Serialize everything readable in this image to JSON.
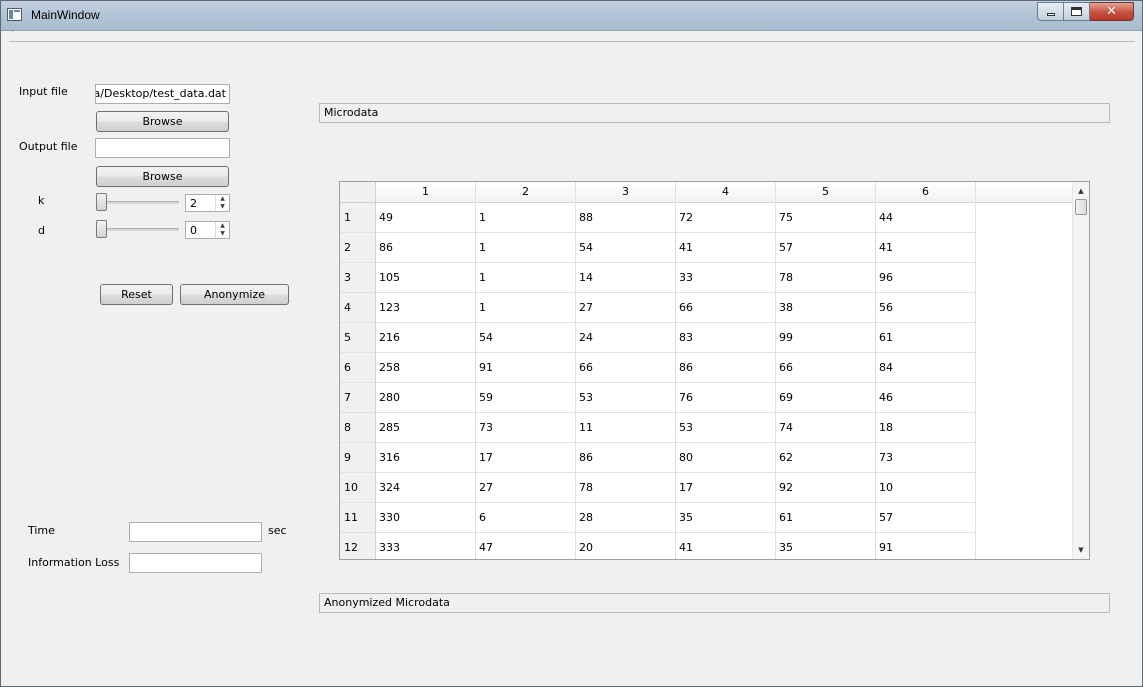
{
  "window": {
    "title": "MainWindow"
  },
  "menubar": {
    "marker": "·"
  },
  "form": {
    "input_label": "Input file",
    "input_value": "rina/Desktop/test_data.dat",
    "browse1_label": "Browse",
    "output_label": "Output file",
    "output_value": "",
    "browse2_label": "Browse",
    "k_label": "k",
    "k_value": "2",
    "d_label": "d",
    "d_value": "0",
    "reset_label": "Reset",
    "anonymize_label": "Anonymize",
    "time_label": "Time",
    "time_value": "",
    "time_unit": "sec",
    "info_loss_label": "Information Loss",
    "info_loss_value": ""
  },
  "microdata": {
    "title": "Microdata",
    "columns": [
      "1",
      "2",
      "3",
      "4",
      "5",
      "6"
    ],
    "row_headers": [
      "1",
      "2",
      "3",
      "4",
      "5",
      "6",
      "7",
      "8",
      "9",
      "10",
      "11",
      "12"
    ],
    "rows": [
      [
        "49",
        "1",
        "88",
        "72",
        "75",
        "44"
      ],
      [
        "86",
        "1",
        "54",
        "41",
        "57",
        "41"
      ],
      [
        "105",
        "1",
        "14",
        "33",
        "78",
        "96"
      ],
      [
        "123",
        "1",
        "27",
        "66",
        "38",
        "56"
      ],
      [
        "216",
        "54",
        "24",
        "83",
        "99",
        "61"
      ],
      [
        "258",
        "91",
        "66",
        "86",
        "66",
        "84"
      ],
      [
        "280",
        "59",
        "53",
        "76",
        "69",
        "46"
      ],
      [
        "285",
        "73",
        "11",
        "53",
        "74",
        "18"
      ],
      [
        "316",
        "17",
        "86",
        "80",
        "62",
        "73"
      ],
      [
        "324",
        "27",
        "78",
        "17",
        "92",
        "10"
      ],
      [
        "330",
        "6",
        "28",
        "35",
        "61",
        "57"
      ],
      [
        "333",
        "47",
        "20",
        "41",
        "35",
        "91"
      ]
    ]
  },
  "anonymized": {
    "title": "Anonymized Microdata"
  }
}
